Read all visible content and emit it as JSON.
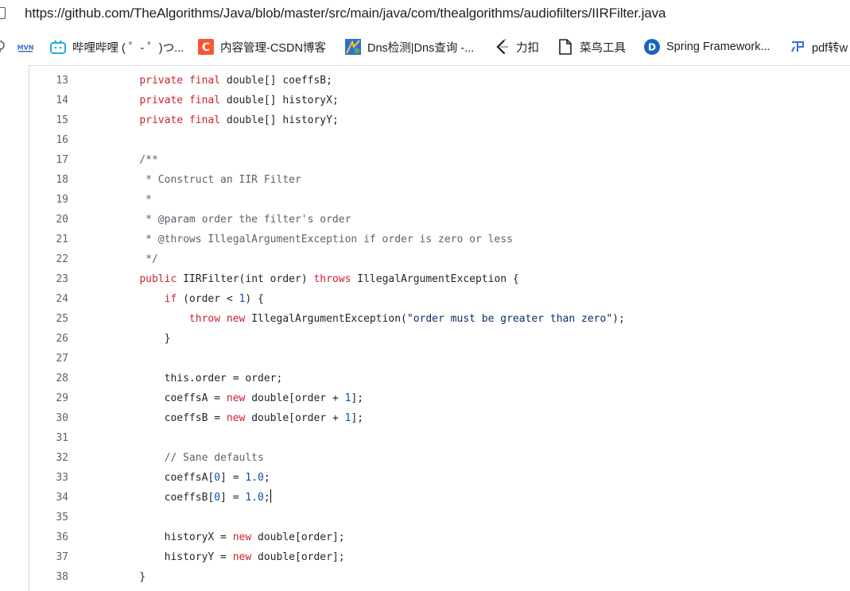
{
  "address_bar": {
    "url": "https://github.com/TheAlgorithms/Java/blob/master/src/main/java/com/thealgorithms/audiofilters/IIRFilter.java"
  },
  "bookmarks": [
    {
      "label": "",
      "icon": "bookmark-icon-partial",
      "color": "#555555"
    },
    {
      "label": "",
      "icon": "mvn-icon",
      "color": "#3f6ec4"
    },
    {
      "label": "哔哩哔哩 ( ゜- ゜)つ...",
      "icon": "bilibili-icon",
      "color": "#23ade5"
    },
    {
      "label": "内容管理-CSDN博客",
      "icon": "csdn-icon",
      "color": "#fc5531"
    },
    {
      "label": "Dns检测|Dns查询 -...",
      "icon": "dns-icon",
      "color": "#2a6fdb"
    },
    {
      "label": "力扣",
      "icon": "leetcode-icon",
      "color": "#1f1f1f"
    },
    {
      "label": "菜鸟工具",
      "icon": "file-icon",
      "color": "#1f1f1f"
    },
    {
      "label": "Spring Framework...",
      "icon": "spring-icon",
      "color": "#1565c0"
    },
    {
      "label": "pdf转w",
      "icon": "pdf-icon",
      "color": "#3b6fd6"
    }
  ],
  "code": {
    "lines": [
      {
        "n": "13",
        "tokens": [
          {
            "t": "    "
          },
          {
            "t": "private",
            "c": "kw"
          },
          {
            "t": " "
          },
          {
            "t": "final",
            "c": "kw"
          },
          {
            "t": " double[] coeffsB;"
          }
        ]
      },
      {
        "n": "14",
        "tokens": [
          {
            "t": "    "
          },
          {
            "t": "private",
            "c": "kw"
          },
          {
            "t": " "
          },
          {
            "t": "final",
            "c": "kw"
          },
          {
            "t": " double[] historyX;"
          }
        ]
      },
      {
        "n": "15",
        "tokens": [
          {
            "t": "    "
          },
          {
            "t": "private",
            "c": "kw"
          },
          {
            "t": " "
          },
          {
            "t": "final",
            "c": "kw"
          },
          {
            "t": " double[] historyY;"
          }
        ]
      },
      {
        "n": "16",
        "tokens": []
      },
      {
        "n": "17",
        "tokens": [
          {
            "t": "    /**",
            "c": "cm"
          }
        ]
      },
      {
        "n": "18",
        "tokens": [
          {
            "t": "     * Construct an IIR Filter",
            "c": "cm"
          }
        ]
      },
      {
        "n": "19",
        "tokens": [
          {
            "t": "     *",
            "c": "cm"
          }
        ]
      },
      {
        "n": "20",
        "tokens": [
          {
            "t": "     * @param order the filter's order",
            "c": "cm"
          }
        ]
      },
      {
        "n": "21",
        "tokens": [
          {
            "t": "     * @throws IllegalArgumentException if order is zero or less",
            "c": "cm"
          }
        ]
      },
      {
        "n": "22",
        "tokens": [
          {
            "t": "     */",
            "c": "cm"
          }
        ]
      },
      {
        "n": "23",
        "tokens": [
          {
            "t": "    "
          },
          {
            "t": "public",
            "c": "kw"
          },
          {
            "t": " IIRFilter(int order) "
          },
          {
            "t": "throws",
            "c": "kw"
          },
          {
            "t": " IllegalArgumentException {"
          }
        ]
      },
      {
        "n": "24",
        "tokens": [
          {
            "t": "        "
          },
          {
            "t": "if",
            "c": "kw"
          },
          {
            "t": " (order < "
          },
          {
            "t": "1",
            "c": "nu"
          },
          {
            "t": ") {"
          }
        ]
      },
      {
        "n": "25",
        "tokens": [
          {
            "t": "            "
          },
          {
            "t": "throw",
            "c": "kw"
          },
          {
            "t": " "
          },
          {
            "t": "new",
            "c": "kw"
          },
          {
            "t": " IllegalArgumentException("
          },
          {
            "t": "\"order must be greater than zero\"",
            "c": "st"
          },
          {
            "t": ");"
          }
        ]
      },
      {
        "n": "26",
        "tokens": [
          {
            "t": "        }"
          }
        ]
      },
      {
        "n": "27",
        "tokens": []
      },
      {
        "n": "28",
        "tokens": [
          {
            "t": "        this.order = order;"
          }
        ]
      },
      {
        "n": "29",
        "tokens": [
          {
            "t": "        coeffsA = "
          },
          {
            "t": "new",
            "c": "kw"
          },
          {
            "t": " double[order + "
          },
          {
            "t": "1",
            "c": "nu"
          },
          {
            "t": "];"
          }
        ]
      },
      {
        "n": "30",
        "tokens": [
          {
            "t": "        coeffsB = "
          },
          {
            "t": "new",
            "c": "kw"
          },
          {
            "t": " double[order + "
          },
          {
            "t": "1",
            "c": "nu"
          },
          {
            "t": "];"
          }
        ]
      },
      {
        "n": "31",
        "tokens": []
      },
      {
        "n": "32",
        "tokens": [
          {
            "t": "        // Sane defaults",
            "c": "cm"
          }
        ]
      },
      {
        "n": "33",
        "tokens": [
          {
            "t": "        coeffsA["
          },
          {
            "t": "0",
            "c": "nu"
          },
          {
            "t": "] = "
          },
          {
            "t": "1.0",
            "c": "nu"
          },
          {
            "t": ";"
          }
        ]
      },
      {
        "n": "34",
        "tokens": [
          {
            "t": "        coeffsB["
          },
          {
            "t": "0",
            "c": "nu"
          },
          {
            "t": "] = "
          },
          {
            "t": "1.0",
            "c": "nu"
          },
          {
            "t": ";"
          }
        ],
        "caret": true
      },
      {
        "n": "35",
        "tokens": []
      },
      {
        "n": "36",
        "tokens": [
          {
            "t": "        historyX = "
          },
          {
            "t": "new",
            "c": "kw"
          },
          {
            "t": " double[order];"
          }
        ]
      },
      {
        "n": "37",
        "tokens": [
          {
            "t": "        historyY = "
          },
          {
            "t": "new",
            "c": "kw"
          },
          {
            "t": " double[order];"
          }
        ]
      },
      {
        "n": "38",
        "tokens": [
          {
            "t": "    }"
          }
        ]
      }
    ]
  },
  "colors": {
    "keyword": "#cf222e",
    "comment": "#59636e",
    "number": "#0550ae",
    "string": "#0a3069",
    "text": "#1f2328"
  }
}
